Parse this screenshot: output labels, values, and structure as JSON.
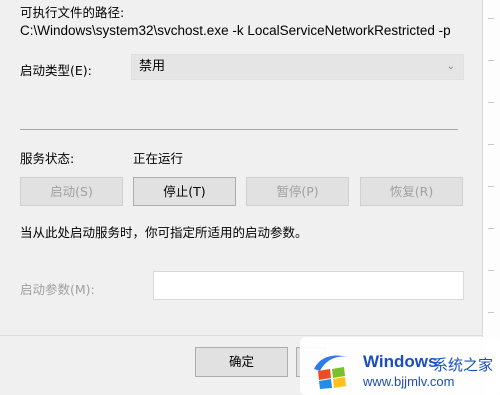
{
  "general": {
    "exe_path_label": "可执行文件的路径:",
    "exe_path_value": "C:\\Windows\\system32\\svchost.exe -k LocalServiceNetworkRestricted -p",
    "startup_type_label": "启动类型(E):",
    "startup_type_value": "禁用",
    "status_label": "服务状态:",
    "status_value": "正在运行",
    "buttons": {
      "start": "启动(S)",
      "stop": "停止(T)",
      "pause": "暂停(P)",
      "resume": "恢复(R)"
    },
    "hint": "当从此处启动服务时，你可指定所适用的启动参数。",
    "param_label": "启动参数(M):",
    "param_value": ""
  },
  "footer": {
    "ok_label": "确定"
  },
  "watermark": {
    "title": "Windows",
    "subtitle": "系统之家",
    "url": "www.bjjmlv.com"
  },
  "colors": {
    "disabled_text": "#a0a0a0",
    "watermark_blue": "#1a4fbf"
  }
}
